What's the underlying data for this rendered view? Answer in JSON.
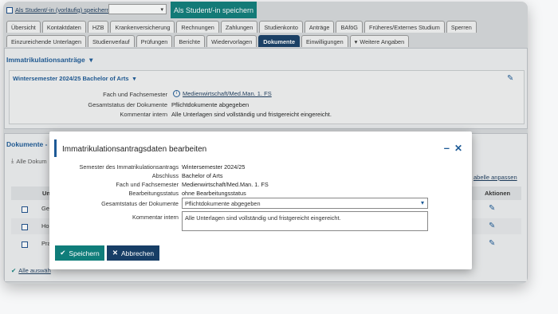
{
  "toolbar": {
    "preliminary_checkbox_label": "Als Student/-in (vorläufig) speichern",
    "save_as_student_button": "Als Student/-in speichern"
  },
  "tabs_row1": [
    "Übersicht",
    "Kontaktdaten",
    "HZB",
    "Krankenversicherung",
    "Rechnungen",
    "Zahlungen",
    "Studienkonto",
    "Anträge",
    "BAföG",
    "Früheres/Externes Studium",
    "Sperren"
  ],
  "tabs_row2": [
    "Einzureichende Unterlagen",
    "Studienverlauf",
    "Prüfungen",
    "Berichte",
    "Wiedervorlagen",
    "Dokumente",
    "Einwilligungen",
    "Weitere Angaben"
  ],
  "active_tab": "Dokumente",
  "applications": {
    "title": "Immatrikulationsanträge",
    "entry_title": "Wintersemester 2024/25 Bachelor of Arts",
    "fields": [
      {
        "label": "Fach und Fachsemester",
        "value": "Medienwirtschaft/Med.Man. 1. FS"
      },
      {
        "label": "Gesamtstatus der Dokumente",
        "value": "Pflichtdokumente abgegeben"
      },
      {
        "label": "Kommentar intern",
        "value": "Alle Unterlagen sind vollständig und fristgereicht eingereicht."
      }
    ]
  },
  "documents": {
    "title": "Dokumente - I",
    "all_docs_label": "Alle Dokum",
    "adjust_table_link": "abelle anpassen",
    "col_un": "Un",
    "col_actions": "Aktionen",
    "rows": [
      "Ges",
      "Ho",
      "Pra"
    ],
    "select_all": "Alle auswäh"
  },
  "modal": {
    "title": "Immatrikulationsantragsdaten bearbeiten",
    "fields": [
      {
        "label": "Semester des Immatrikulationsantrags",
        "value": "Wintersemester 2024/25"
      },
      {
        "label": "Abschluss",
        "value": "Bachelor of Arts"
      },
      {
        "label": "Fach und Fachsemester",
        "value": "Medienwirtschaft/Med.Man. 1. FS"
      },
      {
        "label": "Bearbeitungsstatus",
        "value": "ohne Bearbeitungsstatus"
      }
    ],
    "status_label": "Gesamtstatus der Dokumente",
    "status_value": "Pflichtdokumente abgegeben",
    "comment_label": "Kommentar intern",
    "comment_value": "Alle Unterlagen sind vollständig und fristgereicht eingereicht.",
    "save_button": "Speichern",
    "cancel_button": "Abbrechen"
  },
  "colors": {
    "teal": "#0f7d7a",
    "navy": "#173e66",
    "link_blue": "#1d5a96"
  }
}
